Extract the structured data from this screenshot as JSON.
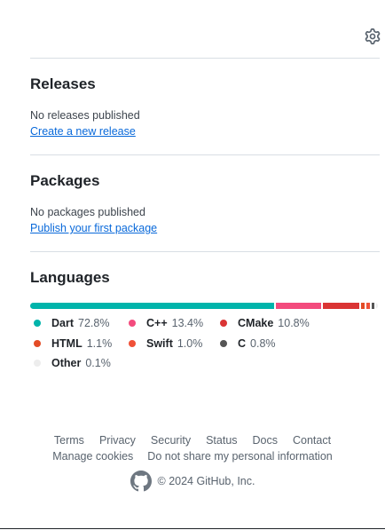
{
  "releases": {
    "title": "Releases",
    "empty": "No releases published",
    "link": "Create a new release"
  },
  "packages": {
    "title": "Packages",
    "empty": "No packages published",
    "link": "Publish your first package"
  },
  "languages": {
    "title": "Languages",
    "items": [
      {
        "name": "Dart",
        "percent": "72.8%",
        "value": 72.8,
        "color": "#00B4AB"
      },
      {
        "name": "C++",
        "percent": "13.4%",
        "value": 13.4,
        "color": "#f34b7d"
      },
      {
        "name": "CMake",
        "percent": "10.8%",
        "value": 10.8,
        "color": "#DA3434"
      },
      {
        "name": "HTML",
        "percent": "1.1%",
        "value": 1.1,
        "color": "#e34c26"
      },
      {
        "name": "Swift",
        "percent": "1.0%",
        "value": 1.0,
        "color": "#F05138"
      },
      {
        "name": "C",
        "percent": "0.8%",
        "value": 0.8,
        "color": "#555555"
      },
      {
        "name": "Other",
        "percent": "0.1%",
        "value": 0.1,
        "color": "#ededed"
      }
    ]
  },
  "footer": {
    "links_row1": [
      "Terms",
      "Privacy",
      "Security",
      "Status",
      "Docs",
      "Contact"
    ],
    "links_row2": [
      "Manage cookies",
      "Do not share my personal information"
    ],
    "copyright": "© 2024 GitHub, Inc.",
    "logo_icon": "github-mark-icon"
  },
  "icons": {
    "settings": "gear-icon"
  }
}
